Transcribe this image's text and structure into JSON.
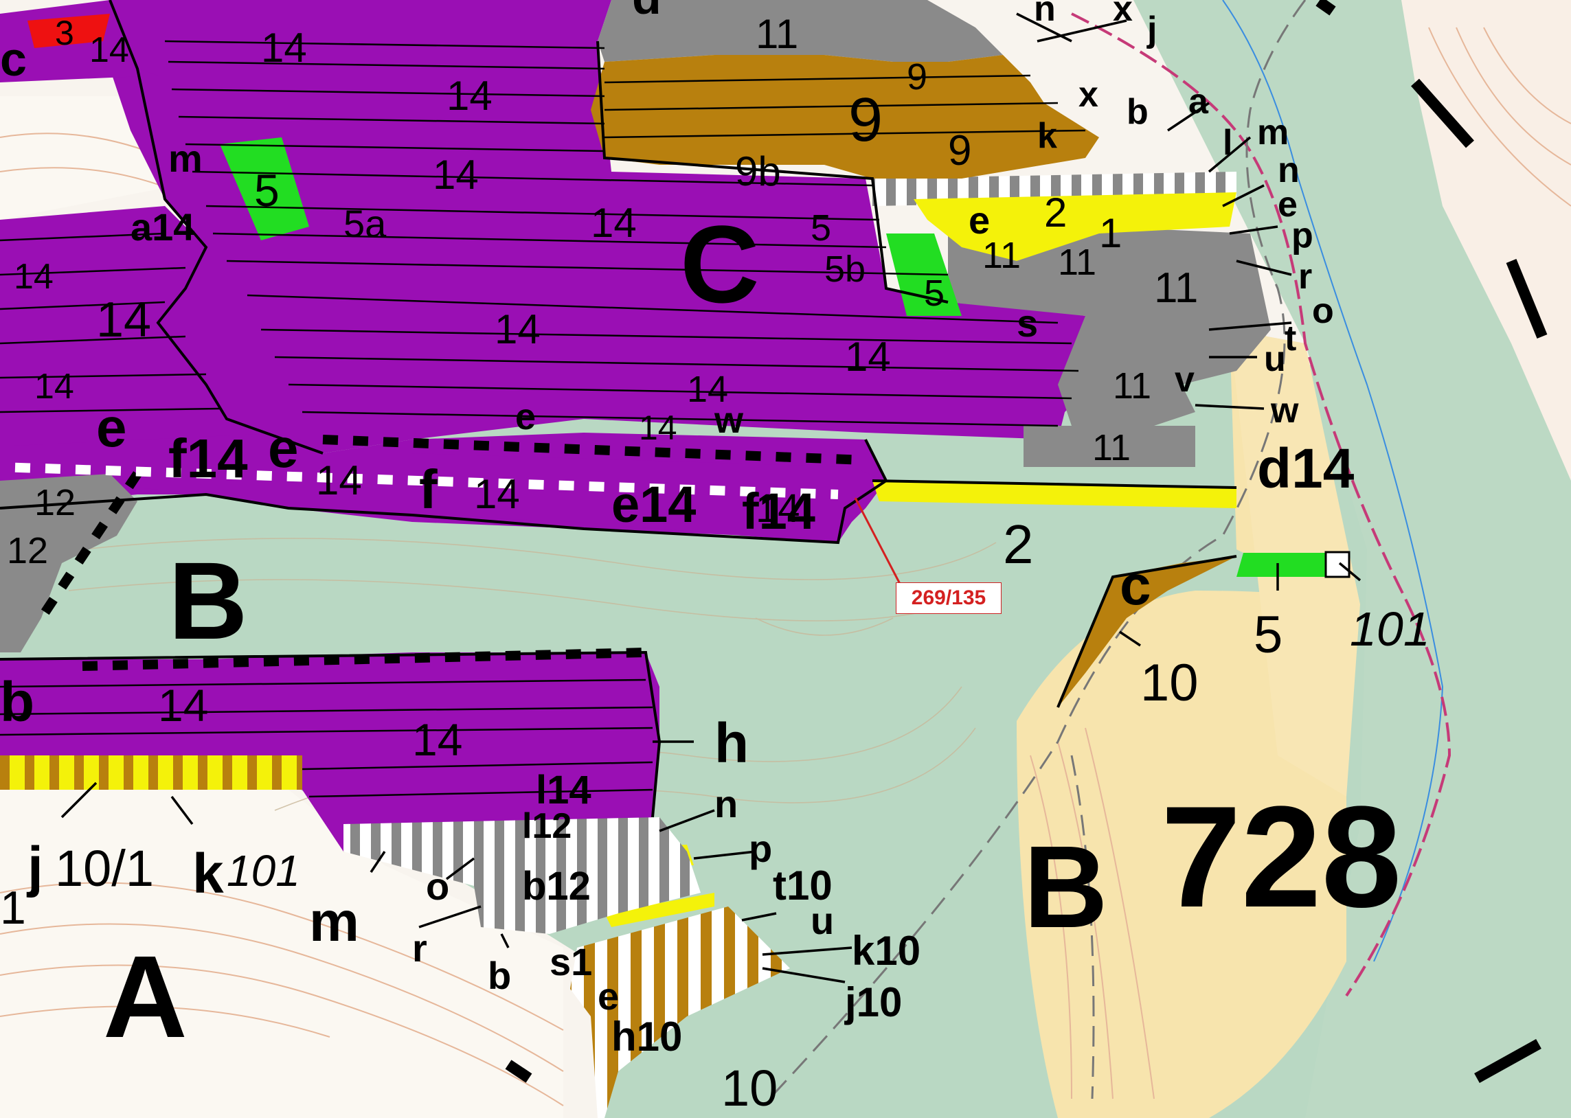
{
  "zones": {
    "A": "A",
    "B_left": "B",
    "B_right": "B",
    "C": "C"
  },
  "parcel_number": "728",
  "callout": {
    "text": "269/135",
    "color": "#d42020"
  },
  "colors": {
    "purple": "#9a0fb4",
    "gray": "#8a8a8a",
    "brown": "#b8800e",
    "yellow": "#f4f20a",
    "green": "#22dd22",
    "red": "#ee1111",
    "forest": "#b8d8c0",
    "cream": "#f8e6b0",
    "white": "#ffffff"
  },
  "labels": {
    "n14": "14",
    "n11": "11",
    "n9": "9",
    "n9b": "9b",
    "n12": "12",
    "n10": "10",
    "n5": "5",
    "n5a": "5a",
    "n5b": "5b",
    "n2": "2",
    "n1": "1",
    "n101": "101",
    "n10_1": "10/1",
    "n3": "3",
    "a": "a",
    "b": "b",
    "c": "c",
    "d": "d",
    "e": "e",
    "f": "f",
    "h": "h",
    "j": "j",
    "k": "k",
    "l": "l",
    "m": "m",
    "n": "n",
    "o": "o",
    "p": "p",
    "r": "r",
    "s": "s",
    "t": "t",
    "u": "u",
    "v": "v",
    "w": "w",
    "x": "x",
    "a14": "a14",
    "f14": "f14",
    "e14": "e14",
    "d14": "d14",
    "s1": "s1",
    "t10": "t10",
    "h10": "h10",
    "k10": "k10",
    "j10": "j10",
    "b12": "b12",
    "l14": "l14",
    "l12": "l12"
  }
}
